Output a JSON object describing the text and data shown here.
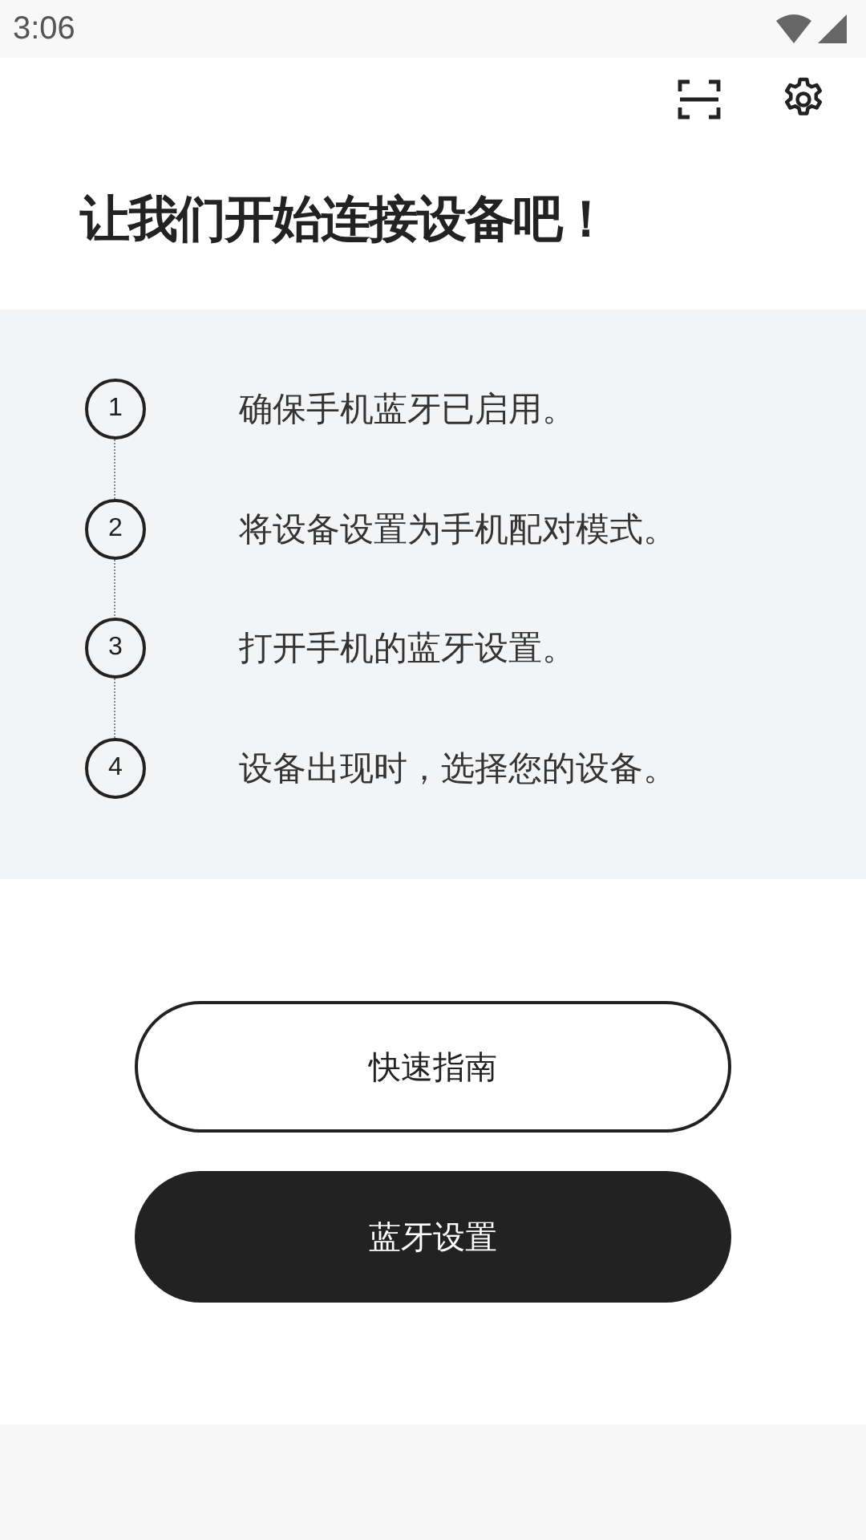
{
  "status_bar": {
    "time": "3:06"
  },
  "title": "让我们开始连接设备吧！",
  "steps": [
    {
      "number": "1",
      "text": "确保手机蓝牙已启用。"
    },
    {
      "number": "2",
      "text": "将设备设置为手机配对模式。"
    },
    {
      "number": "3",
      "text": "打开手机的蓝牙设置。"
    },
    {
      "number": "4",
      "text": "设备出现时，选择您的设备。"
    }
  ],
  "buttons": [
    {
      "label": "快速指南",
      "kind": "outline"
    },
    {
      "label": "蓝牙设置",
      "kind": "filled"
    }
  ]
}
